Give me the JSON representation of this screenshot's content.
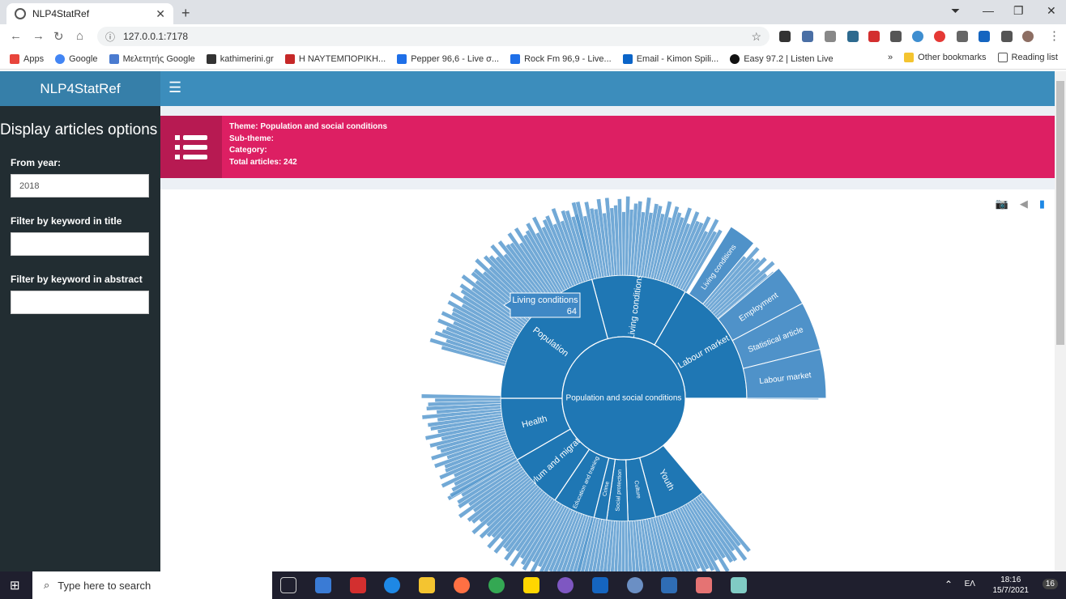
{
  "browser": {
    "tab_title": "NLP4StatRef",
    "url": "127.0.0.1:7178",
    "bookmarks": [
      "Apps",
      "Google",
      "Μελετητής Google",
      "kathimerini.gr",
      "Η ΝΑΥΤΕΜΠΟΡΙΚΗ...",
      "Pepper 96,6 - Live σ...",
      "Rock Fm 96,9 - Live...",
      "Email - Kimon Spili...",
      "Easy 97.2 | Listen Live"
    ],
    "bookmarks_more": "»",
    "other_bookmarks": "Other bookmarks",
    "reading_list": "Reading list"
  },
  "app": {
    "brand": "NLP4StatRef",
    "menu_icon": "hamburger-icon"
  },
  "sidebar": {
    "title": "Display articles options",
    "from_year_label": "From year:",
    "from_year_value": "2018",
    "title_filter_label": "Filter by keyword in title",
    "title_filter_value": "",
    "abstract_filter_label": "Filter by keyword in abstract",
    "abstract_filter_value": ""
  },
  "infobox": {
    "theme": "Theme: Population and social conditions",
    "subtheme": "Sub-theme:",
    "category": "Category:",
    "total": "Total articles: 242"
  },
  "chart_data": {
    "type": "sunburst",
    "root": "Population and social conditions",
    "segments": [
      "Living conditions",
      "Labour market",
      "Health",
      "Asylum and migration",
      "Education and training",
      "Youth",
      "Culture",
      "Social protection",
      "Crime",
      "Population"
    ],
    "tooltip": {
      "label": "Living conditions",
      "value": 64
    },
    "outer_labels": [
      "Living conditions",
      "Population",
      "Employment",
      "Statistical article",
      "Labour market",
      "Statistical article",
      "Asylum and migration",
      "Population",
      "Statistical"
    ]
  },
  "taskbar": {
    "search_placeholder": "Type here to search",
    "lang": "ΕΛ",
    "time": "18:16",
    "date": "15/7/2021",
    "notifications": "16"
  }
}
